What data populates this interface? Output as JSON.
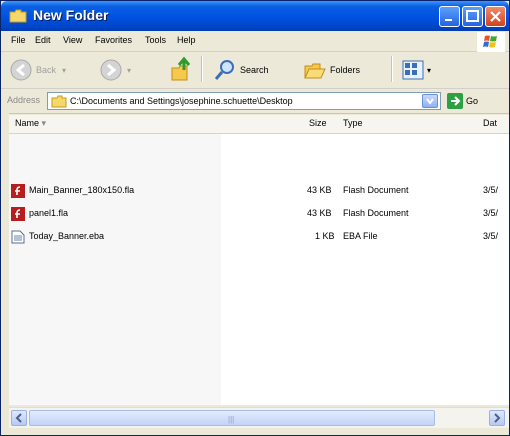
{
  "window": {
    "title": "New Folder"
  },
  "menu": [
    "File",
    "Edit",
    "View",
    "Favorites",
    "Tools",
    "Help"
  ],
  "toolbar": {
    "back_label": "Back",
    "search_label": "Search",
    "folders_label": "Folders"
  },
  "address": {
    "label": "Address",
    "path": "C:\\Documents and Settings\\josephine.schuette\\Desktop",
    "go_label": "Go"
  },
  "columns": {
    "name": "Name",
    "size": "Size",
    "type": "Type",
    "date": "Dat"
  },
  "files": [
    {
      "name": "Main_Banner_180x150.fla",
      "size": "43 KB",
      "type": "Flash Document",
      "date": "3/5/",
      "icon": "flash-document-icon"
    },
    {
      "name": "panel1.fla",
      "size": "43 KB",
      "type": "Flash Document",
      "date": "3/5/",
      "icon": "flash-document-icon"
    },
    {
      "name": "Today_Banner.eba",
      "size": "1 KB",
      "type": "EBA File",
      "date": "3/5/",
      "icon": "generic-file-icon"
    }
  ],
  "scrollbar": {
    "grip": "|||"
  },
  "colors": {
    "titlebar": "#0054e3",
    "close": "#d2421c",
    "go": "#2ea043",
    "flash": "#b51f1f"
  }
}
